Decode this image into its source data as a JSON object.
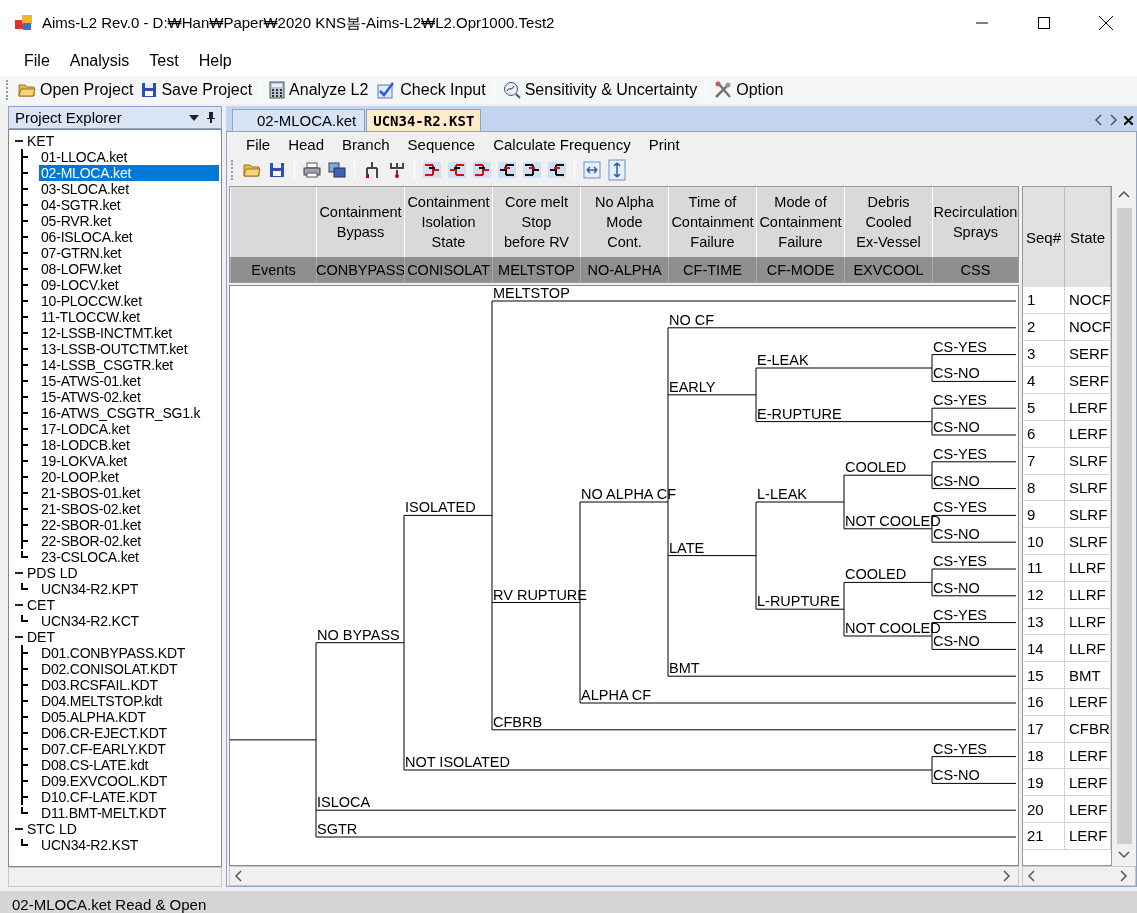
{
  "window": {
    "title": "Aims-L2 Rev.0 - D:₩Han₩Paper₩2020 KNS봄-Aims-L2₩L2.Opr1000.Test2"
  },
  "menu": [
    "File",
    "Analysis",
    "Test",
    "Help"
  ],
  "toolbar": [
    [
      "Open Project",
      "Save Project"
    ],
    [
      "Analyze L2",
      "Check Input"
    ],
    [
      "Sensitivity & Uncertainty"
    ],
    [
      "Option"
    ]
  ],
  "explorer": {
    "title": "Project Explorer",
    "groups": [
      {
        "label": "KET",
        "expanded": true,
        "items": [
          {
            "label": "01-LLOCA.ket",
            "selected": false
          },
          {
            "label": "02-MLOCA.ket",
            "selected": true
          },
          {
            "label": "03-SLOCA.ket",
            "selected": false
          },
          {
            "label": "04-SGTR.ket",
            "selected": false
          },
          {
            "label": "05-RVR.ket",
            "selected": false
          },
          {
            "label": "06-ISLOCA.ket",
            "selected": false
          },
          {
            "label": "07-GTRN.ket",
            "selected": false
          },
          {
            "label": "08-LOFW.ket",
            "selected": false
          },
          {
            "label": "09-LOCV.ket",
            "selected": false
          },
          {
            "label": "10-PLOCCW.ket",
            "selected": false
          },
          {
            "label": "11-TLOCCW.ket",
            "selected": false
          },
          {
            "label": "12-LSSB-INCTMT.ket",
            "selected": false
          },
          {
            "label": "13-LSSB-OUTCTMT.ket",
            "selected": false
          },
          {
            "label": "14-LSSB_CSGTR.ket",
            "selected": false
          },
          {
            "label": "15-ATWS-01.ket",
            "selected": false
          },
          {
            "label": "15-ATWS-02.ket",
            "selected": false
          },
          {
            "label": "16-ATWS_CSGTR_SG1.k",
            "selected": false
          },
          {
            "label": "17-LODCA.ket",
            "selected": false
          },
          {
            "label": "18-LODCB.ket",
            "selected": false
          },
          {
            "label": "19-LOKVA.ket",
            "selected": false
          },
          {
            "label": "20-LOOP.ket",
            "selected": false
          },
          {
            "label": "21-SBOS-01.ket",
            "selected": false
          },
          {
            "label": "21-SBOS-02.ket",
            "selected": false
          },
          {
            "label": "22-SBOR-01.ket",
            "selected": false
          },
          {
            "label": "22-SBOR-02.ket",
            "selected": false
          },
          {
            "label": "23-CSLOCA.ket",
            "selected": false
          }
        ]
      },
      {
        "label": "PDS LD",
        "expanded": true,
        "items": [
          {
            "label": "UCN34-R2.KPT",
            "selected": false
          }
        ]
      },
      {
        "label": "CET",
        "expanded": true,
        "items": [
          {
            "label": "UCN34-R2.KCT",
            "selected": false
          }
        ]
      },
      {
        "label": "DET",
        "expanded": true,
        "items": [
          {
            "label": "D01.CONBYPASS.KDT",
            "selected": false
          },
          {
            "label": "D02.CONISOLAT.KDT",
            "selected": false
          },
          {
            "label": "D03.RCSFAIL.KDT",
            "selected": false
          },
          {
            "label": "D04.MELTSTOP.kdt",
            "selected": false
          },
          {
            "label": "D05.ALPHA.KDT",
            "selected": false
          },
          {
            "label": "D06.CR-EJECT.KDT",
            "selected": false
          },
          {
            "label": "D07.CF-EARLY.KDT",
            "selected": false
          },
          {
            "label": "D08.CS-LATE.kdt",
            "selected": false
          },
          {
            "label": "D09.EXVCOOL.KDT",
            "selected": false
          },
          {
            "label": "D10.CF-LATE.KDT",
            "selected": false
          },
          {
            "label": "D11.BMT-MELT.KDT",
            "selected": false
          }
        ]
      },
      {
        "label": "STC LD",
        "expanded": true,
        "items": [
          {
            "label": "UCN34-R2.KST",
            "selected": false
          }
        ]
      }
    ]
  },
  "tabs": [
    {
      "label": "02-MLOCA.ket",
      "selected": false
    },
    {
      "label": "UCN34-R2.KST",
      "selected": true
    }
  ],
  "doc_menu": [
    "File",
    "Head",
    "Branch",
    "Sequence",
    "Calculate Frequency",
    "Print"
  ],
  "events": [
    {
      "code": "Events"
    },
    {
      "description": "Containment\nBypass",
      "code": "CONBYPASS"
    },
    {
      "description": "Containment\nIsolation\nState",
      "code": "CONISOLAT"
    },
    {
      "description": "Core melt\nStop\nbefore RV",
      "code": "MELTSTOP"
    },
    {
      "description": "No Alpha\nMode\nCont.",
      "code": "NO-ALPHA"
    },
    {
      "description": "Time of\nContainment\nFailure",
      "code": "CF-TIME"
    },
    {
      "description": "Mode of\nContainment\nFailure",
      "code": "CF-MODE"
    },
    {
      "description": "Debris\nCooled\nEx-Vessel",
      "code": "EXVCOOL"
    },
    {
      "description": "Recirculation\nSprays",
      "code": "CSS"
    }
  ],
  "event_tree": {
    "children": [
      {
        "label": "NO BYPASS",
        "children": [
          {
            "label": "ISOLATED",
            "children": [
              {
                "label": "MELTSTOP"
              },
              {
                "label": "RV RUPTURE",
                "children": [
                  {
                    "label": "NO ALPHA CF",
                    "children": [
                      {
                        "label": "NO CF"
                      },
                      {
                        "label": "EARLY",
                        "children": [
                          {
                            "label": "E-LEAK",
                            "children": [
                              {
                                "children": [
                                  {
                                    "label": "CS-YES"
                                  },
                                  {
                                    "label": "CS-NO"
                                  }
                                ]
                              }
                            ]
                          },
                          {
                            "label": "E-RUPTURE",
                            "children": [
                              {
                                "children": [
                                  {
                                    "label": "CS-YES"
                                  },
                                  {
                                    "label": "CS-NO"
                                  }
                                ]
                              }
                            ]
                          }
                        ]
                      },
                      {
                        "label": "LATE",
                        "children": [
                          {
                            "label": "L-LEAK",
                            "children": [
                              {
                                "label": "COOLED",
                                "children": [
                                  {
                                    "label": "CS-YES"
                                  },
                                  {
                                    "label": "CS-NO"
                                  }
                                ]
                              },
                              {
                                "label": "NOT COOLED",
                                "children": [
                                  {
                                    "label": "CS-YES"
                                  },
                                  {
                                    "label": "CS-NO"
                                  }
                                ]
                              }
                            ]
                          },
                          {
                            "label": "L-RUPTURE",
                            "children": [
                              {
                                "label": "COOLED",
                                "children": [
                                  {
                                    "label": "CS-YES"
                                  },
                                  {
                                    "label": "CS-NO"
                                  }
                                ]
                              },
                              {
                                "label": "NOT COOLED",
                                "children": [
                                  {
                                    "label": "CS-YES"
                                  },
                                  {
                                    "label": "CS-NO"
                                  }
                                ]
                              }
                            ]
                          }
                        ]
                      },
                      {
                        "label": "BMT"
                      }
                    ]
                  },
                  {
                    "label": "ALPHA CF"
                  }
                ]
              },
              {
                "label": "CFBRB"
              }
            ]
          },
          {
            "label": "NOT ISOLATED",
            "children": [
              {
                "children": [
                  {
                    "children": [
                      {
                        "children": [
                          {
                            "children": [
                              {
                                "children": [
                                  {
                                    "label": "CS-YES"
                                  },
                                  {
                                    "label": "CS-NO"
                                  }
                                ]
                              }
                            ]
                          }
                        ]
                      }
                    ]
                  }
                ]
              }
            ]
          }
        ]
      },
      {
        "label": "ISLOCA"
      },
      {
        "label": "SGTR"
      }
    ]
  },
  "sequences": {
    "columns": [
      "Seq#",
      "State"
    ],
    "rows": [
      {
        "seq": "1",
        "state": "NOCF"
      },
      {
        "seq": "2",
        "state": "NOCF"
      },
      {
        "seq": "3",
        "state": "SERF"
      },
      {
        "seq": "4",
        "state": "SERF"
      },
      {
        "seq": "5",
        "state": "LERF"
      },
      {
        "seq": "6",
        "state": "LERF"
      },
      {
        "seq": "7",
        "state": "SLRF"
      },
      {
        "seq": "8",
        "state": "SLRF"
      },
      {
        "seq": "9",
        "state": "SLRF"
      },
      {
        "seq": "10",
        "state": "SLRF"
      },
      {
        "seq": "11",
        "state": "LLRF"
      },
      {
        "seq": "12",
        "state": "LLRF"
      },
      {
        "seq": "13",
        "state": "LLRF"
      },
      {
        "seq": "14",
        "state": "LLRF"
      },
      {
        "seq": "15",
        "state": "BMT"
      },
      {
        "seq": "16",
        "state": "LERF"
      },
      {
        "seq": "17",
        "state": "CFBR"
      },
      {
        "seq": "18",
        "state": "LERF"
      },
      {
        "seq": "19",
        "state": "LERF"
      },
      {
        "seq": "20",
        "state": "LERF"
      },
      {
        "seq": "21",
        "state": "LERF"
      }
    ]
  },
  "status_bar": "02-MLOCA.ket Read & Open"
}
